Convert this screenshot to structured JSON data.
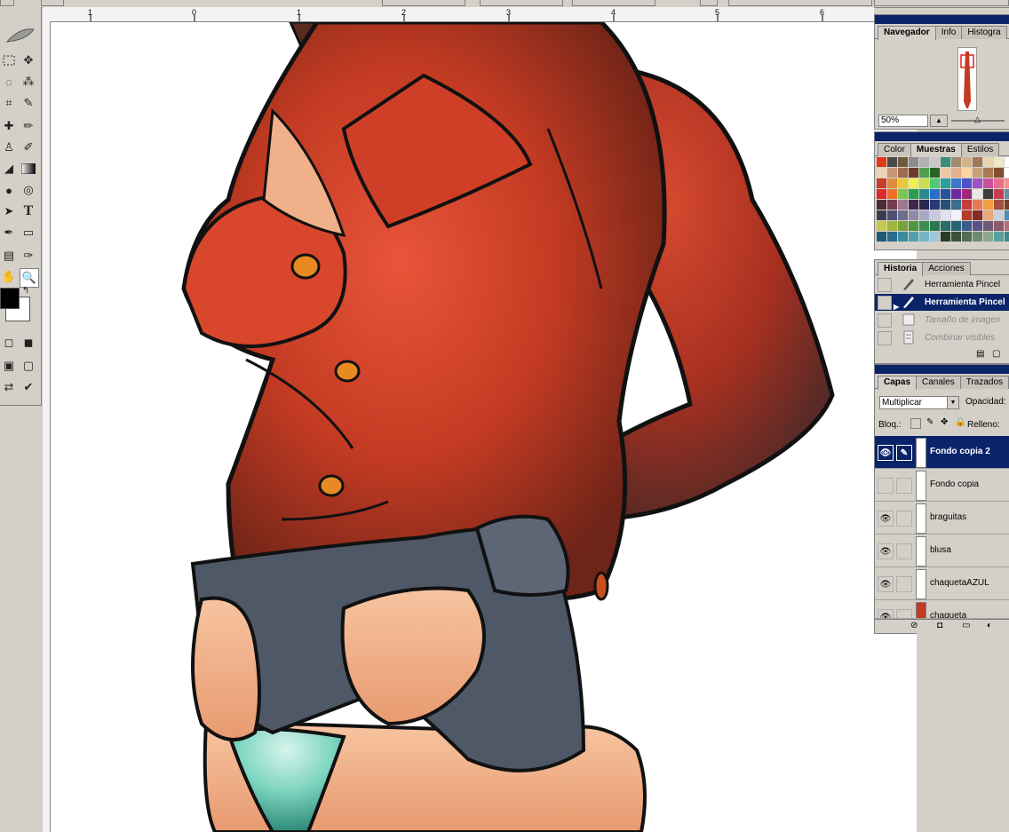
{
  "ruler": {
    "ticks": [
      "1",
      "0",
      "1",
      "2",
      "3",
      "4",
      "5",
      "6"
    ]
  },
  "navigator": {
    "tabs": [
      "Navegador",
      "Info",
      "Histogra"
    ],
    "zoom": "50%"
  },
  "swatches": {
    "tabs": [
      "Color",
      "Muestras",
      "Estilos"
    ],
    "colors": [
      "#e03a1c",
      "#4a4a4a",
      "#6e5a3c",
      "#8c8c8c",
      "#b0b0b0",
      "#c8c8c8",
      "#3c8c78",
      "#a08c6e",
      "#d2b48c",
      "#a0785a",
      "#e8d8b0",
      "#f0e8c8",
      "#ffffff",
      "#f0d2b4",
      "#c89678",
      "#a06c50",
      "#6e3c28",
      "#50a050",
      "#286428",
      "#f0c8a0",
      "#e0b090",
      "#ffd2a0",
      "#c8a078",
      "#a87850",
      "#805030",
      "#ffffff",
      "#c83c28",
      "#e08c3c",
      "#e8c83c",
      "#f0f050",
      "#c8e050",
      "#50c878",
      "#28a0a0",
      "#3c78c8",
      "#5050c8",
      "#a050c8",
      "#c850a0",
      "#e86e8c",
      "#ff8c8c",
      "#e02828",
      "#f06e28",
      "#78c850",
      "#28a050",
      "#288c8c",
      "#286ec8",
      "#2850a0",
      "#6e28a0",
      "#a02878",
      "#e8e8e8",
      "#3c3c3c",
      "#c83c50",
      "#6e8ca0",
      "#50283c",
      "#783c50",
      "#a0788c",
      "#3c2850",
      "#282850",
      "#283c78",
      "#285078",
      "#3c6e8c",
      "#c83c3c",
      "#e87850",
      "#f0a03c",
      "#a0503c",
      "#784028",
      "#3c3c50",
      "#50506e",
      "#6e6e8c",
      "#8c8ca8",
      "#a8a8c8",
      "#c8c8e0",
      "#e0e0f0",
      "#f0f0ff",
      "#b43c28",
      "#8c2828",
      "#e8a878",
      "#c8d2dc",
      "#508cb4",
      "#c8c850",
      "#a0b43c",
      "#78a03c",
      "#50963c",
      "#3c8c50",
      "#287850",
      "#286e6e",
      "#286478",
      "#3c5a8c",
      "#5a508c",
      "#6e5a78",
      "#8c5a6e",
      "#b46e78",
      "#1e5a78",
      "#286e8c",
      "#3c8ca0",
      "#50a0b4",
      "#78b4c8",
      "#a0c8dc",
      "#283c28",
      "#3c503c",
      "#506e50",
      "#6e8c6e",
      "#8ca88c",
      "#5aa0a0",
      "#3c8c8c"
    ]
  },
  "history": {
    "tabs": [
      "Historia",
      "Acciones"
    ],
    "items": [
      {
        "label": "Herramienta Pincel"
      },
      {
        "label": "Herramienta Pincel"
      },
      {
        "label": "Tamaño de imagen"
      },
      {
        "label": "Combinar visibles"
      }
    ]
  },
  "layers": {
    "tabs": [
      "Capas",
      "Canales",
      "Trazados"
    ],
    "blend_mode": "Multiplicar",
    "opacity_label": "Opacidad:",
    "lock_label": "Bloq.:",
    "fill_label": "Relleno:",
    "items": [
      {
        "name": "Fondo copia 2",
        "visible": true
      },
      {
        "name": "Fondo copia",
        "visible": false
      },
      {
        "name": "braguitas",
        "visible": true
      },
      {
        "name": "blusa",
        "visible": true
      },
      {
        "name": "chaquetaAZUL",
        "visible": true
      },
      {
        "name": "chaqueta",
        "visible": true
      }
    ]
  },
  "colors": {
    "panel_bg": "#d4d0c8",
    "title_bar": "#0a246a",
    "jacket_red": "#c23a22",
    "jacket_dark": "#6e2418",
    "skirt_gray": "#4e5866",
    "skin": "#f0b08a",
    "panty_teal": "#7fd6c0"
  }
}
